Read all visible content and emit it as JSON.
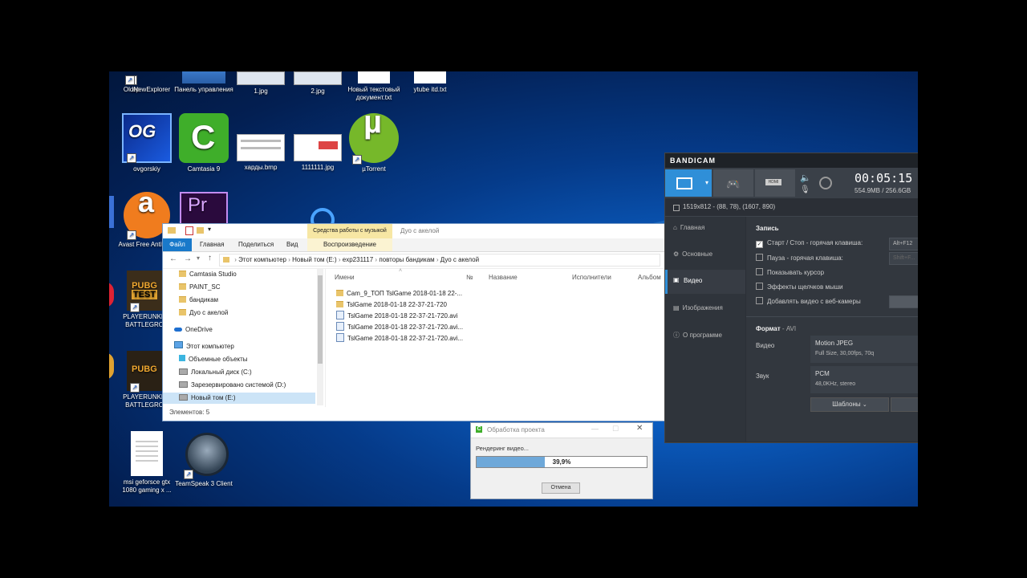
{
  "desktop": {
    "icons": [
      {
        "id": "oldnew",
        "label": "OldNewExplorer"
      },
      {
        "id": "panel",
        "label": "Панель управления"
      },
      {
        "id": "jpg1",
        "label": "1.jpg"
      },
      {
        "id": "jpg2",
        "label": "2.jpg"
      },
      {
        "id": "newtxt",
        "label": "Новый текстовый документ.txt"
      },
      {
        "id": "ytube",
        "label": "ytube itd.txt"
      },
      {
        "id": "ovgorskiy",
        "label": "ovgorskiy"
      },
      {
        "id": "camtasia",
        "label": "Camtasia 9"
      },
      {
        "id": "hardy",
        "label": "харды.bmp"
      },
      {
        "id": "j1111",
        "label": "1111111.jpg"
      },
      {
        "id": "utorrent",
        "label": "µTorrent"
      },
      {
        "id": "avast",
        "label": "Avast Free Antivirus"
      },
      {
        "id": "pubg1",
        "label": "PLAYERUNKNO BATTLEGROU"
      },
      {
        "id": "pubg2",
        "label": "PLAYERUNKNO BATTLEGROU"
      },
      {
        "id": "msi",
        "label": "msi geforsce gtx 1080 gaming x ..."
      },
      {
        "id": "teamspeak",
        "label": "TeamSpeak 3 Client"
      },
      {
        "id": "edge_partial",
        "label": "ер"
      }
    ]
  },
  "explorer": {
    "contextual_tab": "Средства работы с музыкой",
    "window_title": "Дуо с акелой",
    "tabs": [
      "Файл",
      "Главная",
      "Поделиться",
      "Вид"
    ],
    "contextual_subtab": "Воспроизведение",
    "breadcrumb": [
      "Этот компьютер",
      "Новый том (E:)",
      "exp231117",
      "повторы бандикам",
      "Дуо с акелой"
    ],
    "nav": {
      "items": [
        {
          "label": "Camtasia Studio",
          "type": "folder"
        },
        {
          "label": "PAINT_SC",
          "type": "folder"
        },
        {
          "label": "бандикам",
          "type": "folder"
        },
        {
          "label": "Дуо с акелой",
          "type": "folder"
        },
        {
          "label": "OneDrive",
          "type": "cloud"
        },
        {
          "label": "Этот компьютер",
          "type": "pc"
        },
        {
          "label": "Объемные объекты",
          "type": "folder3d"
        },
        {
          "label": "Локальный диск (C:)",
          "type": "drive"
        },
        {
          "label": "Зарезервировано системой (D:)",
          "type": "drive"
        },
        {
          "label": "Новый том (E:)",
          "type": "drive"
        }
      ]
    },
    "columns": [
      "Имени",
      "№",
      "Название",
      "Исполнители",
      "Альбом"
    ],
    "files": [
      {
        "name": "Cam_9_ТОП TslGame 2018-01-18 22-...",
        "type": "folder"
      },
      {
        "name": "TslGame 2018-01-18 22-37-21-720",
        "type": "folder"
      },
      {
        "name": "TslGame 2018-01-18 22-37-21-720.avi",
        "type": "video"
      },
      {
        "name": "TslGame 2018-01-18 22-37-21-720.avi...",
        "type": "video"
      },
      {
        "name": "TslGame 2018-01-18 22-37-21-720.avi...",
        "type": "video"
      }
    ],
    "status": "Элементов: 5"
  },
  "bandicam": {
    "brand": "BANDICAM",
    "timer": "00:05:15",
    "size": "554.9MB / 256.6GB",
    "region": "1519x812 - (88, 78), (1607, 890)",
    "side": [
      "Главная",
      "Основные",
      "Видео",
      "Изображения",
      "О программе"
    ],
    "active_side": "Видео",
    "record_header": "Запись",
    "options": [
      {
        "label": "Старт / Стоп - горячая клавиша:",
        "checked": true,
        "value": "Alt+F12"
      },
      {
        "label": "Пауза - горячая клавиша:",
        "checked": false,
        "value": "Shift+F..."
      },
      {
        "label": "Показывать курсор",
        "checked": false
      },
      {
        "label": "Эффекты щелчков мыши",
        "checked": false
      },
      {
        "label": "Добавлять видео с веб-камеры",
        "checked": false
      }
    ],
    "format_header": "Формат",
    "format_value": "AVI",
    "video_label": "Видео",
    "video_codec": "Motion JPEG",
    "video_detail": "Full Size, 30,00fps, 70q",
    "audio_label": "Звук",
    "audio_codec": "PCM",
    "audio_detail": "48,0KHz, stereo",
    "templates_btn": "Шаблоны"
  },
  "render": {
    "title": "Обработка проекта",
    "label": "Рендеринг видео...",
    "progress_text": "39,9%",
    "progress": 0.399,
    "cancel": "Отмена"
  },
  "colors": {
    "accent": "#2f8fd8",
    "bandicam_bg": "#2b2f36",
    "progress": "#5b9bd5"
  }
}
